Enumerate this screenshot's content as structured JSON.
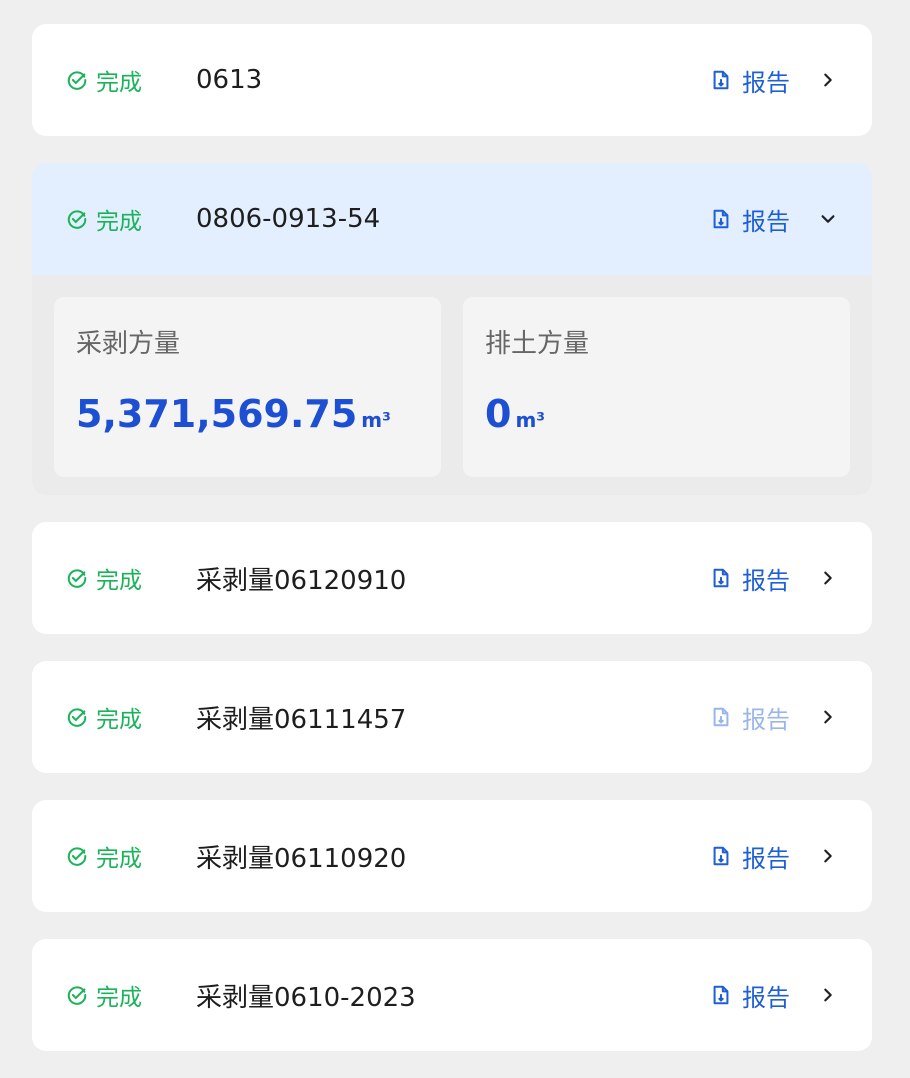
{
  "colors": {
    "success": "#1bb35a",
    "link": "#1f5fd6",
    "value": "#1c4fd2",
    "expanded_header_bg": "#e3efff"
  },
  "items": [
    {
      "status": "完成",
      "name": "0613",
      "report_label": "报告",
      "chevron": "chevron-right-icon"
    },
    {
      "status": "完成",
      "name": "0806-0913-54",
      "report_label": "报告",
      "chevron": "chevron-down-icon",
      "expanded": true
    },
    {
      "status": "完成",
      "name": "采剥量06120910",
      "report_label": "报告",
      "chevron": "chevron-right-icon"
    },
    {
      "status": "完成",
      "name": "采剥量06111457",
      "report_label": "报告",
      "chevron": "chevron-right-icon"
    },
    {
      "status": "完成",
      "name": "采剥量06110920",
      "report_label": "报告",
      "chevron": "chevron-right-icon"
    },
    {
      "status": "完成",
      "name": "采剥量0610-2023",
      "report_label": "报告",
      "chevron": "chevron-right-icon"
    }
  ],
  "expanded": {
    "stats": [
      {
        "label": "采剥方量",
        "value": "5,371,569.75",
        "unit": "m³"
      },
      {
        "label": "排土方量",
        "value": "0",
        "unit": "m³"
      }
    ]
  }
}
